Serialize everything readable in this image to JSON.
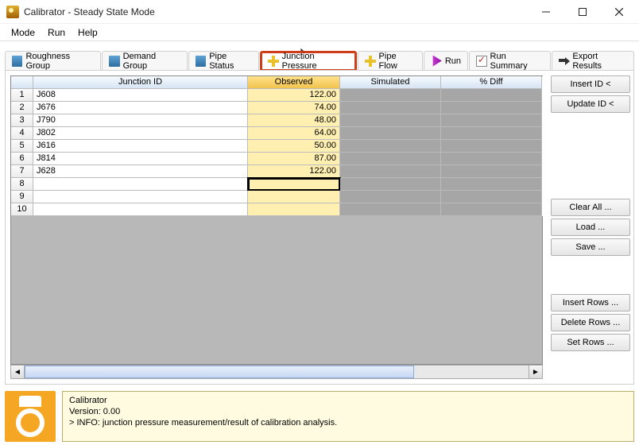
{
  "window": {
    "title": "Calibrator - Steady State Mode"
  },
  "menu": [
    "Mode",
    "Run",
    "Help"
  ],
  "tabs": [
    {
      "label": "Roughness Group",
      "icon": "folder"
    },
    {
      "label": "Demand Group",
      "icon": "folder"
    },
    {
      "label": "Pipe Status",
      "icon": "folder"
    },
    {
      "label": "Junction Pressure",
      "icon": "junc",
      "active": true
    },
    {
      "label": "Pipe Flow",
      "icon": "junc"
    },
    {
      "label": "Run",
      "icon": "run"
    },
    {
      "label": "Run Summary",
      "icon": "doc"
    },
    {
      "label": "Export Results",
      "icon": "export"
    }
  ],
  "grid": {
    "columns": [
      "Junction ID",
      "Observed",
      "Simulated",
      "% Diff"
    ],
    "rows": [
      {
        "n": 1,
        "id": "J608",
        "obs": "122.00"
      },
      {
        "n": 2,
        "id": "J676",
        "obs": "74.00"
      },
      {
        "n": 3,
        "id": "J790",
        "obs": "48.00"
      },
      {
        "n": 4,
        "id": "J802",
        "obs": "64.00"
      },
      {
        "n": 5,
        "id": "J616",
        "obs": "50.00"
      },
      {
        "n": 6,
        "id": "J814",
        "obs": "87.00"
      },
      {
        "n": 7,
        "id": "J628",
        "obs": "122.00"
      },
      {
        "n": 8,
        "id": "",
        "obs": ""
      },
      {
        "n": 9,
        "id": "",
        "obs": ""
      },
      {
        "n": 10,
        "id": "",
        "obs": ""
      }
    ],
    "selected_row": 8
  },
  "side_buttons": {
    "group1": [
      "Insert ID <",
      "Update ID <"
    ],
    "group2": [
      "Clear All ...",
      "Load ...",
      "Save ..."
    ],
    "group3": [
      "Insert Rows ...",
      "Delete Rows ...",
      "Set Rows ..."
    ]
  },
  "status": {
    "title": "Calibrator",
    "version": "Version: 0.00",
    "info": "> INFO: junction pressure measurement/result of calibration analysis."
  }
}
